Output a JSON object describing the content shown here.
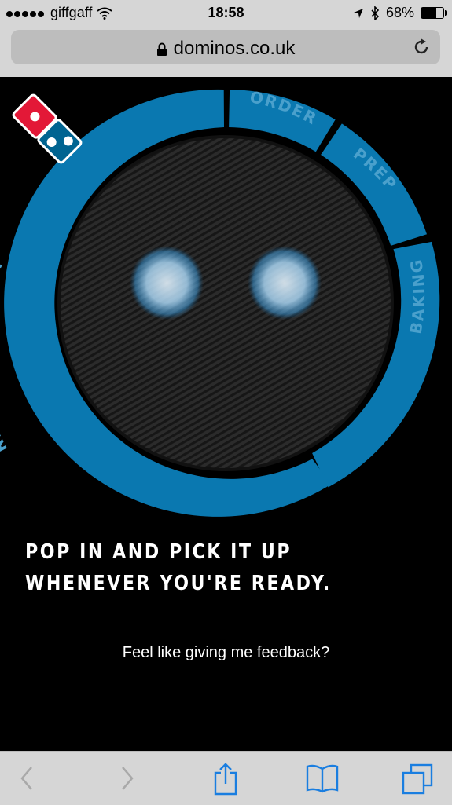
{
  "status_bar": {
    "carrier": "giffgaff",
    "time": "18:58",
    "battery_percent": "68%",
    "battery_level": 0.68,
    "icons": [
      "signal-dots-icon",
      "wifi-icon",
      "location-arrow-icon",
      "bluetooth-icon",
      "battery-icon"
    ]
  },
  "browser": {
    "url": "dominos.co.uk",
    "icons": [
      "lock-icon",
      "reload-icon"
    ]
  },
  "tracker": {
    "stages": [
      "ORDER",
      "PREP",
      "BAKING",
      "READY TO COLLECT"
    ],
    "current_stage": "READY TO COLLECT",
    "colors": {
      "ring": "#0a78b0",
      "ring_label": "#4aa0cc",
      "background": "#000000",
      "face": "#2a2a2a",
      "eyes": "#9fcff0"
    }
  },
  "message": {
    "headline": "POP IN AND PICK IT UP WHENEVER YOU'RE READY.",
    "feedback": "Feel like giving me feedback?"
  },
  "toolbar": {
    "icons": [
      "back-icon",
      "forward-icon",
      "share-icon",
      "bookmarks-icon",
      "tabs-icon"
    ],
    "accent": "#1a7ee0"
  }
}
